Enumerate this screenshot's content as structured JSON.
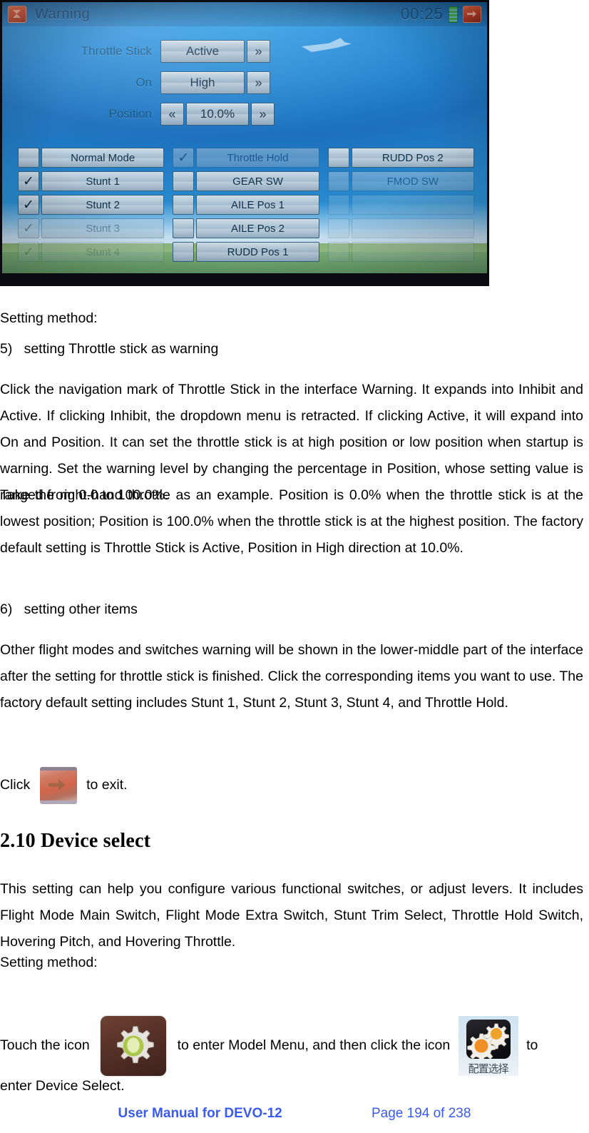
{
  "screenshot": {
    "device_photo": {
      "titlebar": {
        "app_icon": "warning-app-icon",
        "title": "Warning",
        "timer": "00:25",
        "battery_icon": "battery-icon",
        "exit_icon": "exit-icon"
      },
      "settings_rows": [
        {
          "label": "Throttle Stick",
          "value": "Active",
          "left_arrow": "",
          "right_arrow": "»"
        },
        {
          "label": "On",
          "value": "High",
          "left_arrow": "",
          "right_arrow": "»"
        },
        {
          "label": "Position",
          "value": "10.0%",
          "left_arrow": "«",
          "right_arrow": "»"
        }
      ],
      "checkbox_grid": {
        "columns": [
          [
            {
              "label": "Normal Mode",
              "checked": false,
              "dim": 0
            },
            {
              "label": "Stunt 1",
              "checked": true,
              "dim": 0
            },
            {
              "label": "Stunt 2",
              "checked": true,
              "dim": 0
            },
            {
              "label": "Stunt 3",
              "checked": true,
              "dim": 1
            },
            {
              "label": "Stunt 4",
              "checked": true,
              "dim": 2
            }
          ],
          [
            {
              "label": "Throttle Hold",
              "checked": true,
              "dim": 1
            },
            {
              "label": "GEAR SW",
              "checked": false,
              "dim": 0
            },
            {
              "label": "AILE Pos 1",
              "checked": false,
              "dim": 0
            },
            {
              "label": "AILE Pos 2",
              "checked": false,
              "dim": 0
            },
            {
              "label": "RUDD Pos 1",
              "checked": false,
              "dim": 0
            }
          ],
          [
            {
              "label": "RUDD Pos 2",
              "checked": false,
              "dim": 0
            },
            {
              "label": "FMOD SW",
              "checked": false,
              "dim": 1
            },
            {
              "label": "",
              "checked": false,
              "dim": 2
            },
            {
              "label": "",
              "checked": false,
              "dim": 2
            },
            {
              "label": "",
              "checked": false,
              "dim": 2
            }
          ]
        ]
      }
    },
    "document": {
      "setting_method_label_1": "Setting method:",
      "list_item_5": "5)   setting Throttle stick as warning",
      "para_1": "Click the navigation mark of Throttle Stick in the interface Warning. It expands into Inhibit and Active. If clicking Inhibit, the dropdown menu is retracted. If clicking Active, it will expand into On and Position. It can set the throttle stick is at high position or low position when startup is warning. Set the warning level by changing the percentage in Position, whose setting value is ranged from 0.0 to 100.0%.",
      "para_2": "Take the right-hand throttle as an example. Position is 0.0% when the throttle stick is at the lowest position; Position is 100.0% when the throttle stick is at the highest position. The factory default setting is Throttle Stick is Active, Position in High direction at 10.0%.",
      "list_item_6": "6)   setting other items",
      "para_3": "Other flight modes and switches warning will be shown in the lower-middle part of the interface after the setting for throttle stick is finished. Click the corresponding items you want to use. The factory default setting includes Stunt 1, Stunt 2, Stunt 3, Stunt 4, and Throttle Hold.",
      "exit_line": {
        "before": "Click",
        "icon": "exit-icon",
        "after": "to exit."
      },
      "section_heading": "2.10 Device select",
      "para_4": "This setting can help you configure various functional switches, or adjust levers. It includes Flight Mode Main Switch, Flight Mode Extra Switch, Stunt Trim Select, Throttle Hold Switch, Hovering Pitch, and Hovering Throttle.",
      "setting_method_label_2": "Setting method:",
      "touch_line": {
        "part1": "Touch the icon",
        "icon1": "model-menu-gear-icon",
        "part2": "to enter Model Menu, and then click the icon",
        "icon2": "device-select-icon",
        "icon2_caption": "配置选择",
        "part3": "to"
      },
      "touch_line_cont": "enter Device Select."
    },
    "footer": {
      "manual": "User Manual for DEVO-12",
      "page": "Page 194 of 238",
      "color": "#3a5bef"
    }
  }
}
